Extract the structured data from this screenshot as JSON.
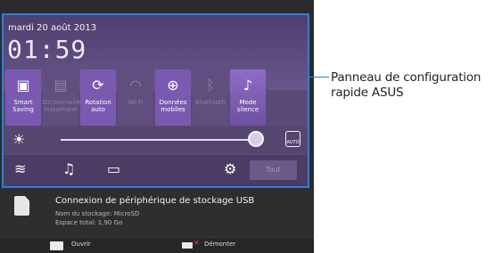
{
  "status": {
    "date": "mardi 20 août 2013",
    "time": "01:59"
  },
  "tiles": [
    {
      "label": "Smart Saving",
      "icon": "smart-saving-icon",
      "state": "on"
    },
    {
      "label": "Dictionnaire instantané",
      "icon": "dictionary-icon",
      "state": "off"
    },
    {
      "label": "Rotation auto",
      "icon": "rotation-icon",
      "state": "on"
    },
    {
      "label": "Wi-Fi",
      "icon": "wifi-icon",
      "state": "off"
    },
    {
      "label": "Données mobiles",
      "icon": "mobile-data-icon",
      "state": "on"
    },
    {
      "label": "Bluetooth",
      "icon": "bluetooth-icon",
      "state": "off"
    },
    {
      "label": "Mode silence",
      "icon": "silent-mode-icon",
      "state": "on"
    }
  ],
  "brightness": {
    "level_percent": 96,
    "auto_label": "AUTO"
  },
  "bottom_bar": {
    "tout_label": "Tout"
  },
  "notification": {
    "title": "Connexion de périphérique de stockage USB",
    "line1": "Nom du stockage: MicroSD",
    "line2": "Espace total: 1,90 Go"
  },
  "actions": {
    "open_label": "Ouvrir",
    "unmount_label": "Démonter"
  },
  "callout": {
    "text": "Panneau de configuration rapide ASUS"
  },
  "colors": {
    "highlight": "#2f7ed8",
    "panel": "#5a4a78",
    "tile_on": "#7a5ab0"
  }
}
